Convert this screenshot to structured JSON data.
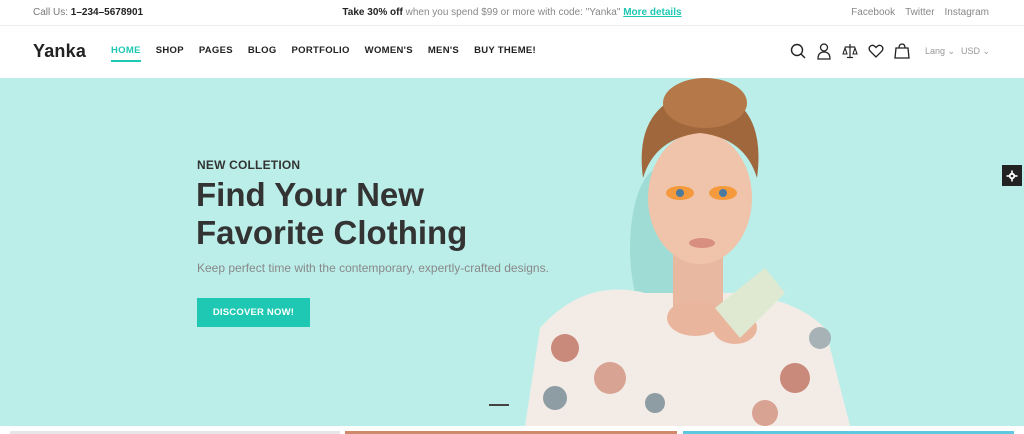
{
  "topbar": {
    "call_label": "Call Us:",
    "phone": "1–234–5678901",
    "promo_bold": "Take 30% off",
    "promo_text": "when you spend $99 or more with code: \"Yanka\"",
    "promo_link": "More details",
    "social": [
      "Facebook",
      "Twitter",
      "Instagram"
    ]
  },
  "header": {
    "logo": "Yanka",
    "nav": [
      "HOME",
      "SHOP",
      "PAGES",
      "BLOG",
      "PORTFOLIO",
      "WOMEN'S",
      "MEN'S",
      "BUY THEME!"
    ],
    "active_nav": "HOME",
    "icons": [
      "search-icon",
      "user-icon",
      "compare-icon",
      "heart-icon",
      "bag-icon"
    ],
    "lang": "Lang",
    "currency": "USD"
  },
  "hero": {
    "kicker": "NEW COLLETION",
    "headline_line1": "Find Your New",
    "headline_line2": "Favorite Clothing",
    "subtext": "Keep perfect time with the contemporary, expertly-crafted designs.",
    "cta": "DISCOVER NOW!"
  },
  "colors": {
    "accent": "#1fc8b3",
    "hero_bg": "#bbeee9"
  }
}
